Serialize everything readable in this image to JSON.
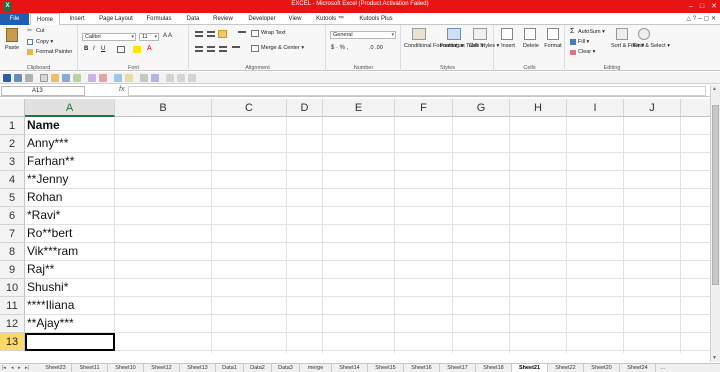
{
  "window": {
    "title": "EXCEL - Microsoft Excel (Product Activation Failed)",
    "app_icon": "X",
    "controls": [
      "–",
      "□",
      "✕"
    ],
    "title_bg": "#e81313"
  },
  "tabs": {
    "file": "File",
    "items": [
      "Home",
      "Insert",
      "Page Layout",
      "Formulas",
      "Data",
      "Review",
      "Developer",
      "View",
      "Kutools ™",
      "Kutools Plus"
    ],
    "active": "Home"
  },
  "ribbon": {
    "clipboard": {
      "paste": "Paste",
      "cut": "Cut",
      "copy": "Copy ▾",
      "format_painter": "Format Painter",
      "label": "Clipboard"
    },
    "font": {
      "font_name": "Calibri",
      "font_size": "11",
      "bold": "B",
      "italic": "I",
      "underline": "U",
      "label": "Font"
    },
    "alignment": {
      "wrap_text": "Wrap Text",
      "merge_center": "Merge & Center ▾",
      "label": "Alignment"
    },
    "number": {
      "format": "General",
      "label": "Number"
    },
    "styles": {
      "conditional": "Conditional Formatting ▾",
      "format_table": "Format as Table ▾",
      "cell_styles": "Cell Styles ▾",
      "label": "Styles"
    },
    "cells": {
      "insert": "Insert",
      "delete": "Delete",
      "format": "Format",
      "label": "Cells"
    },
    "editing": {
      "autosum": "AutoSum ▾",
      "fill": "Fill ▾",
      "clear": "Clear ▾",
      "sort_filter": "Sort & Filter ▾",
      "find_select": "Find & Select ▾",
      "label": "Editing"
    }
  },
  "formula_bar": {
    "name_box": "A13",
    "fx": "fx",
    "content": ""
  },
  "grid": {
    "columns": [
      "A",
      "B",
      "C",
      "D",
      "E",
      "F",
      "G",
      "H",
      "I",
      "J"
    ],
    "selected_column": "A",
    "rows": [
      "1",
      "2",
      "3",
      "4",
      "5",
      "6",
      "7",
      "8",
      "9",
      "10",
      "11",
      "12",
      "13"
    ],
    "selected_row": "13",
    "column_a": [
      "Name",
      "Anny***",
      "Farhan**",
      "**Jenny",
      "Rohan",
      "*Ravi*",
      "Ro**bert",
      "Vik***ram",
      "Raj**",
      "Shushi*",
      "****Iliana",
      "**Ajay***",
      ""
    ]
  },
  "sheets": {
    "items": [
      "Sheet23",
      "Sheet11",
      "Sheet10",
      "Sheet12",
      "Sheet13",
      "Data1",
      "Data2",
      "Data3",
      "merge",
      "Sheet14",
      "Sheet15",
      "Sheet16",
      "Sheet17",
      "Sheet18",
      "Sheet21",
      "Sheet22",
      "Sheet20",
      "Sheet24"
    ],
    "active": "Sheet21",
    "more": "..."
  }
}
